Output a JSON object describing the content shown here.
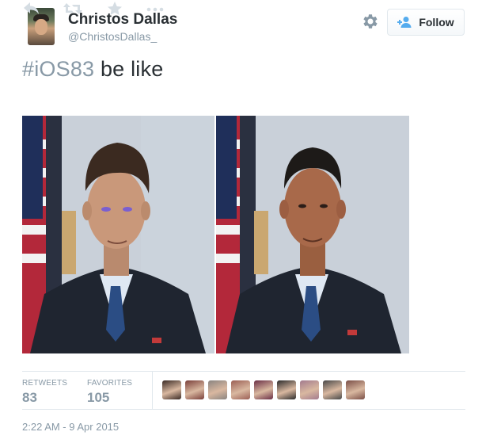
{
  "author": {
    "name": "Christos Dallas",
    "handle": "@ChristosDallas_"
  },
  "header": {
    "follow_label": "Follow",
    "settings_icon": "gear-icon",
    "follow_icon": "add-user-icon"
  },
  "tweet": {
    "hashtag": "#iOS83",
    "text": " be like",
    "timestamp": "2:22 AM - 9 Apr 2015"
  },
  "actions": [
    {
      "name": "reply-icon"
    },
    {
      "name": "retweet-icon"
    },
    {
      "name": "favorite-icon"
    },
    {
      "name": "more-icon"
    }
  ],
  "stats": {
    "retweets_label": "RETWEETS",
    "retweets_value": "83",
    "favorites_label": "FAVORITES",
    "favorites_value": "105"
  },
  "favoriters": [
    {
      "color": "#3a2a24"
    },
    {
      "color": "#7a3f3a"
    },
    {
      "color": "#8a8480"
    },
    {
      "color": "#9b5f55"
    },
    {
      "color": "#6a2e45"
    },
    {
      "color": "#2b2b2b"
    },
    {
      "color": "#a37b8e"
    },
    {
      "color": "#484848"
    },
    {
      "color": "#7a4e46"
    }
  ],
  "colors": {
    "text": "#292f33",
    "muted": "#8899a6",
    "border": "#e1e8ed",
    "link_blue": "#55acee"
  }
}
